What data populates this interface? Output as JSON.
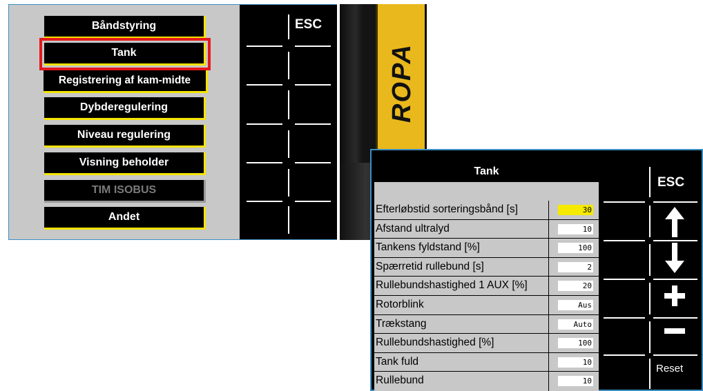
{
  "menu_screen": {
    "items": [
      {
        "label": "Båndstyring",
        "state": "normal"
      },
      {
        "label": "Tank",
        "state": "selected"
      },
      {
        "label": "Registrering af kam-midte",
        "state": "normal"
      },
      {
        "label": "Dybderegulering",
        "state": "normal"
      },
      {
        "label": "Niveau regulering",
        "state": "normal"
      },
      {
        "label": "Visning beholder",
        "state": "normal"
      },
      {
        "label": "TIM ISOBUS",
        "state": "disabled"
      },
      {
        "label": "Andet",
        "state": "normal"
      }
    ],
    "softkeys": {
      "esc_label": "ESC"
    }
  },
  "photo": {
    "brand_text": "ROPA",
    "colors": {
      "brand_yellow": "#e9b81c"
    }
  },
  "tank_screen": {
    "title": "Tank",
    "rows": [
      {
        "label": "Efterløbstid sorteringsbånd [s]",
        "value": "30",
        "highlighted": true
      },
      {
        "label": "Afstand ultralyd",
        "value": "10"
      },
      {
        "label": "Tankens fyldstand [%]",
        "value": "100"
      },
      {
        "label": "Spærretid rullebund [s]",
        "value": "2"
      },
      {
        "label": "Rullebundshastighed 1 AUX [%]",
        "value": "20"
      },
      {
        "label": "Rotorblink",
        "value": "Aus"
      },
      {
        "label": "Trækstang",
        "value": "Auto"
      },
      {
        "label": "Rullebundshastighed [%]",
        "value": "100"
      },
      {
        "label": "Tank fuld",
        "value": "10"
      },
      {
        "label": "Rullebund",
        "value": "10"
      }
    ],
    "softkeys": {
      "esc_label": "ESC",
      "up_icon": "arrow-up-icon",
      "down_icon": "arrow-down-icon",
      "plus_icon": "plus-icon",
      "minus_icon": "minus-icon",
      "reset_label": "Reset"
    }
  },
  "colors": {
    "selection_frame": "#e5191d",
    "accent_yellow": "#f5e400",
    "panel_gray": "#c8c8c8",
    "screen_border": "#3b8fc4"
  }
}
